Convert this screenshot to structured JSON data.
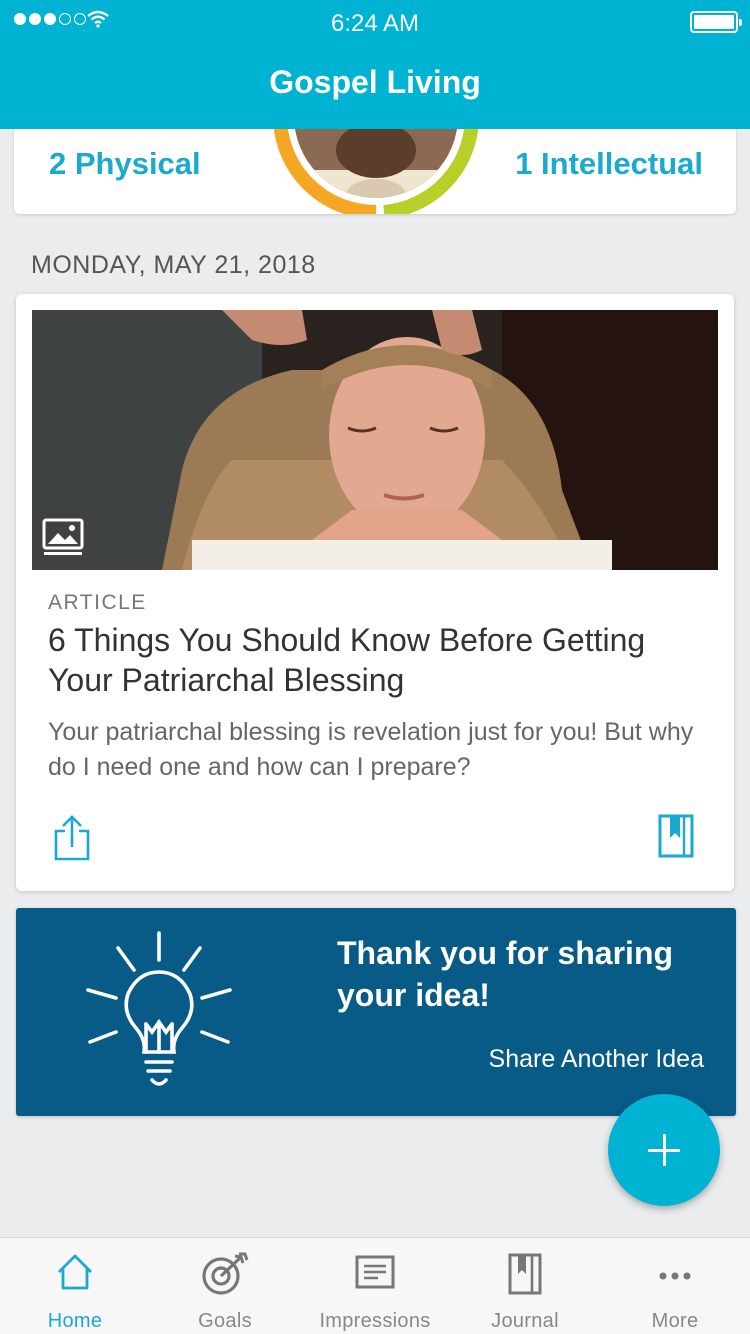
{
  "status_bar": {
    "time": "6:24 AM"
  },
  "header": {
    "title": "Gospel Living"
  },
  "summary": {
    "left_label": "2 Physical",
    "right_label": "1 Intellectual"
  },
  "feed": {
    "date": "MONDAY, MAY 21, 2018",
    "article": {
      "kind": "ARTICLE",
      "title": "6 Things You Should Know Before Getting Your Patriarchal Blessing",
      "description": "Your patriarchal blessing is revelation just for you! But why do I need one and how can I prepare?",
      "media_icon": "image-gallery-icon",
      "actions": [
        "share-icon",
        "bookmark-icon"
      ]
    },
    "idea_card": {
      "message": "Thank you for sharing your idea!",
      "link": "Share Another Idea",
      "icon": "lightbulb-icon"
    }
  },
  "fab": {
    "icon": "plus-icon"
  },
  "bottom_nav": [
    {
      "label": "Home",
      "icon": "home-icon",
      "active": true
    },
    {
      "label": "Goals",
      "icon": "target-icon",
      "active": false
    },
    {
      "label": "Impressions",
      "icon": "impressions-icon",
      "active": false
    },
    {
      "label": "Journal",
      "icon": "journal-icon",
      "active": false
    },
    {
      "label": "More",
      "icon": "more-icon",
      "active": false
    }
  ],
  "colors": {
    "accent": "#00b3d3",
    "idea_card": "#075b86",
    "ring_orange": "#f5a623",
    "ring_green": "#b8cf28"
  }
}
